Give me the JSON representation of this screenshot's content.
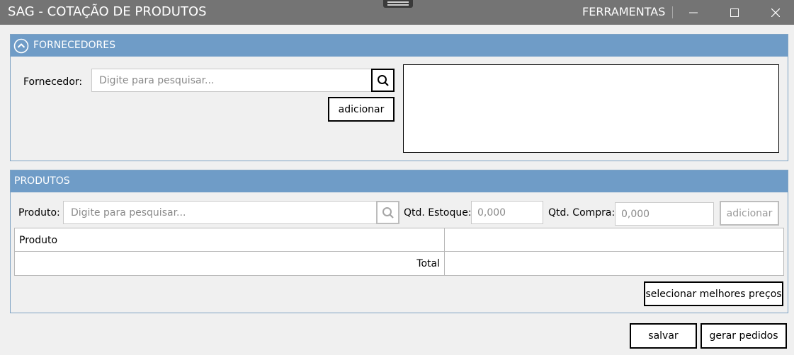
{
  "window": {
    "title": "SAG - COTAÇÃO DE PRODUTOS",
    "menu_tools": "FERRAMENTAS",
    "controls": [
      "minimize-icon",
      "maximize-icon",
      "close-icon"
    ]
  },
  "fornecedores": {
    "header": "FORNECEDORES",
    "collapse_icon": "chevron-up-circle-icon",
    "field_label": "Fornecedor:",
    "search_placeholder": "Digite para pesquisar...",
    "search_icon": "search-icon",
    "add_button": "adicionar",
    "selected_list": []
  },
  "produtos": {
    "header": "PRODUTOS",
    "product_label": "Produto:",
    "search_placeholder": "Digite para pesquisar...",
    "search_icon": "search-icon",
    "stock_label": "Qtd. Estoque:",
    "stock_value": "0,000",
    "purchase_label": "Qtd. Compra:",
    "purchase_value": "0,000",
    "add_button": "adicionar",
    "table": {
      "column_header": "Produto",
      "total_label": "Total"
    },
    "best_prices_button": "selecionar melhores preços"
  },
  "footer": {
    "save_button": "salvar",
    "generate_orders_button": "gerar pedidos"
  },
  "colors": {
    "titlebar": "#747474",
    "panel_header": "#6f9cc7",
    "background": "#f0f0f0"
  }
}
